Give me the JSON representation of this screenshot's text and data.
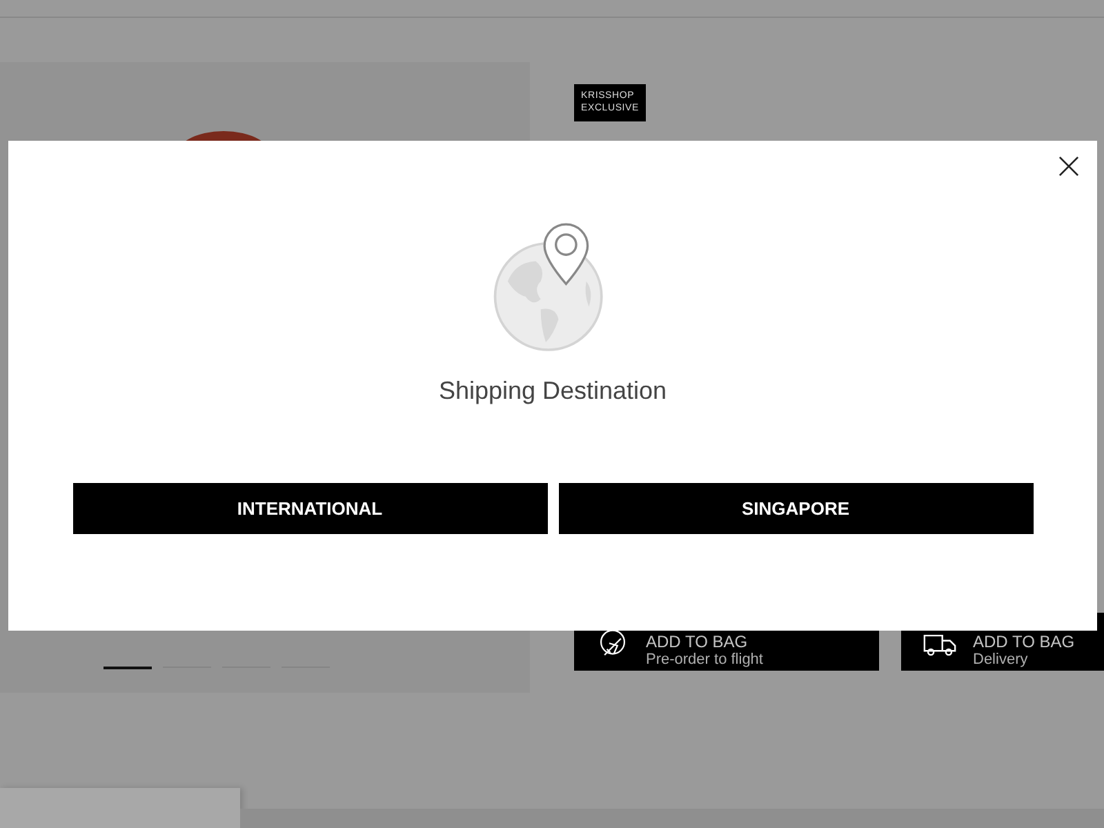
{
  "product": {
    "badge": [
      "KRISSHOP",
      "EXCLUSIVE"
    ],
    "carousel": [
      {
        "selected": true
      },
      {
        "selected": false
      },
      {
        "selected": false
      },
      {
        "selected": false
      }
    ],
    "actions": [
      {
        "kind": "plane",
        "label": "ADD TO BAG",
        "sublabel": "Pre-order to flight"
      },
      {
        "kind": "truck",
        "label": "ADD TO BAG",
        "sublabel": "Delivery"
      }
    ]
  },
  "modal": {
    "title": "Shipping Destination",
    "options": [
      {
        "label": "INTERNATIONAL"
      },
      {
        "label": "SINGAPORE"
      }
    ]
  }
}
